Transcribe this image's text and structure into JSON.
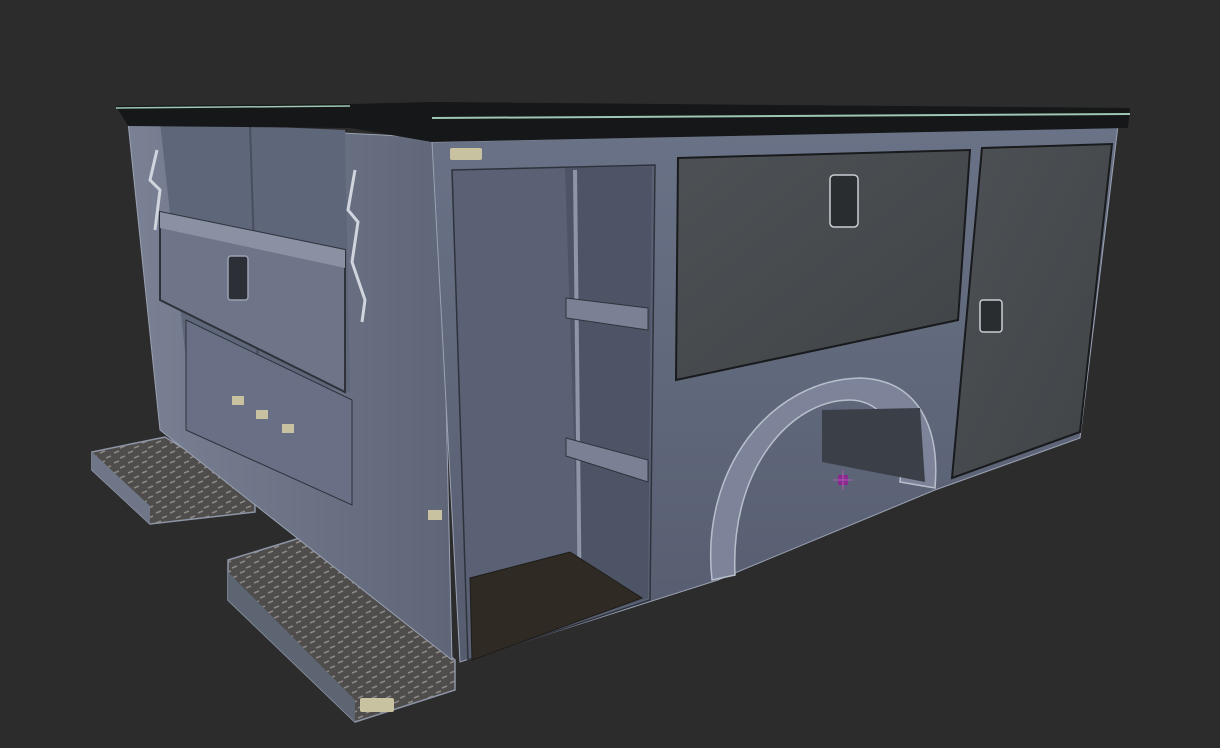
{
  "viewport": {
    "background": "#2c2c2c"
  },
  "model": {
    "subject": "utility-service-truck-body",
    "colors": {
      "body_side": "#5d6578",
      "body_side_light": "#7a8296",
      "body_rear": "#6c7386",
      "panel_dark": "#4a4e52",
      "panel_door": "#3f4346",
      "roof_edge": "#151718",
      "roof_highlight": "#9fc7b5",
      "floor": "#2f2b24",
      "tread_plate": "#5c5a58",
      "light_lens": "#c9c2a0",
      "pivot_marker": "#8a2a8e"
    }
  }
}
